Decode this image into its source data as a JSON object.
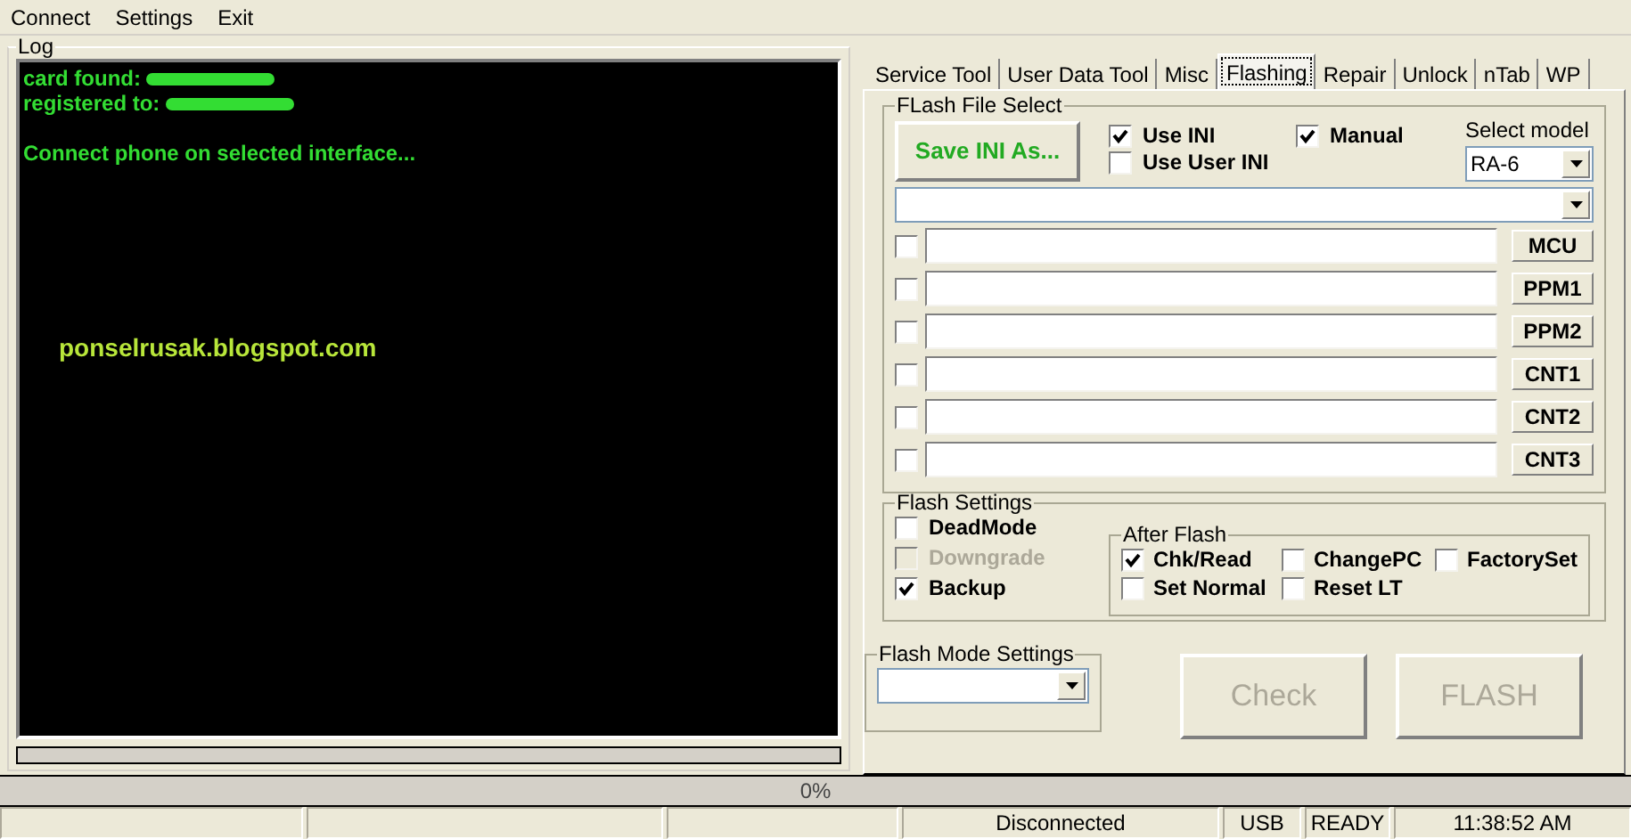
{
  "menu": [
    "Connect",
    "Settings",
    "Exit"
  ],
  "log": {
    "title": "Log",
    "lines": [
      {
        "text": "card found:",
        "redacted": true
      },
      {
        "text": "registered to:",
        "redacted": true
      },
      {
        "text": "Connect phone on selected interface...",
        "redacted": false
      }
    ],
    "watermark": "ponselrusak.blogspot.com",
    "progress": {
      "level": 0
    }
  },
  "tabs": [
    {
      "label": "Service Tool",
      "selected": false
    },
    {
      "label": "User Data Tool",
      "selected": false
    },
    {
      "label": "Misc",
      "selected": false
    },
    {
      "label": "Flashing",
      "selected": true
    },
    {
      "label": "Repair",
      "selected": false
    },
    {
      "label": "Unlock",
      "selected": false
    },
    {
      "label": "nTab",
      "selected": false
    },
    {
      "label": "WP",
      "selected": false
    }
  ],
  "flash_file_select": {
    "title": "FLash File Select",
    "save_button": "Save INI As...",
    "options": [
      {
        "label": "Use INI",
        "checked": true
      },
      {
        "label": "Manual",
        "checked": true
      },
      {
        "label": "Use User INI",
        "checked": false
      }
    ],
    "select_model": {
      "label": "Select model",
      "value": "RA-6"
    },
    "files": [
      {
        "button": "MCU",
        "checked": false
      },
      {
        "button": "PPM1",
        "checked": false
      },
      {
        "button": "PPM2",
        "checked": false
      },
      {
        "button": "CNT1",
        "checked": false
      },
      {
        "button": "CNT2",
        "checked": false
      },
      {
        "button": "CNT3",
        "checked": false
      }
    ]
  },
  "flash_settings": {
    "title": "Flash Settings",
    "options": [
      {
        "label": "DeadMode",
        "checked": false,
        "disabled": false
      },
      {
        "label": "Downgrade",
        "checked": false,
        "disabled": true
      },
      {
        "label": "Backup",
        "checked": true,
        "disabled": false
      }
    ],
    "after_flash": {
      "title": "After Flash",
      "options": [
        {
          "label": "Chk/Read",
          "checked": true
        },
        {
          "label": "ChangePC",
          "checked": false
        },
        {
          "label": "FactorySet",
          "checked": false
        },
        {
          "label": "Set Normal",
          "checked": false
        },
        {
          "label": "Reset LT",
          "checked": false
        }
      ]
    }
  },
  "flash_mode_settings": {
    "title": "Flash Mode Settings"
  },
  "action_buttons": [
    {
      "label": "Check",
      "disabled": true
    },
    {
      "label": "FLASH",
      "disabled": true
    }
  ],
  "progress": {
    "level": 0,
    "reading": "0%"
  },
  "status_bar": [
    "Disconnected",
    "USB",
    "READY",
    "11:38:52 AM"
  ]
}
